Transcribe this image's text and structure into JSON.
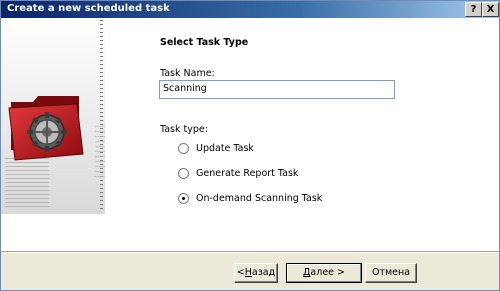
{
  "window": {
    "title": "Create a new scheduled task",
    "help_glyph": "?",
    "close_glyph": "X"
  },
  "main": {
    "section_title": "Select Task Type",
    "task_name_label": "Task Name:",
    "task_name_value": "Scanning",
    "task_type_label": "Task type:",
    "options": [
      {
        "label": "Update Task",
        "selected": false
      },
      {
        "label": "Generate Report Task",
        "selected": false
      },
      {
        "label": "On-demand Scanning Task",
        "selected": true
      }
    ]
  },
  "buttons": {
    "back_prefix": "<",
    "back_underlined": "Н",
    "back_rest": "азад",
    "next_underlined": "Д",
    "next_rest": "алее >",
    "cancel": "Отмена"
  },
  "colors": {
    "title_bar_start": "#0a246a",
    "title_bar_end": "#a6caf0",
    "dialog_bg": "#ece9d8",
    "folder_red": "#c4161c"
  },
  "icons": {
    "wizard_image": "red-folder-gear-icon",
    "help": "help-icon",
    "close": "close-icon"
  }
}
